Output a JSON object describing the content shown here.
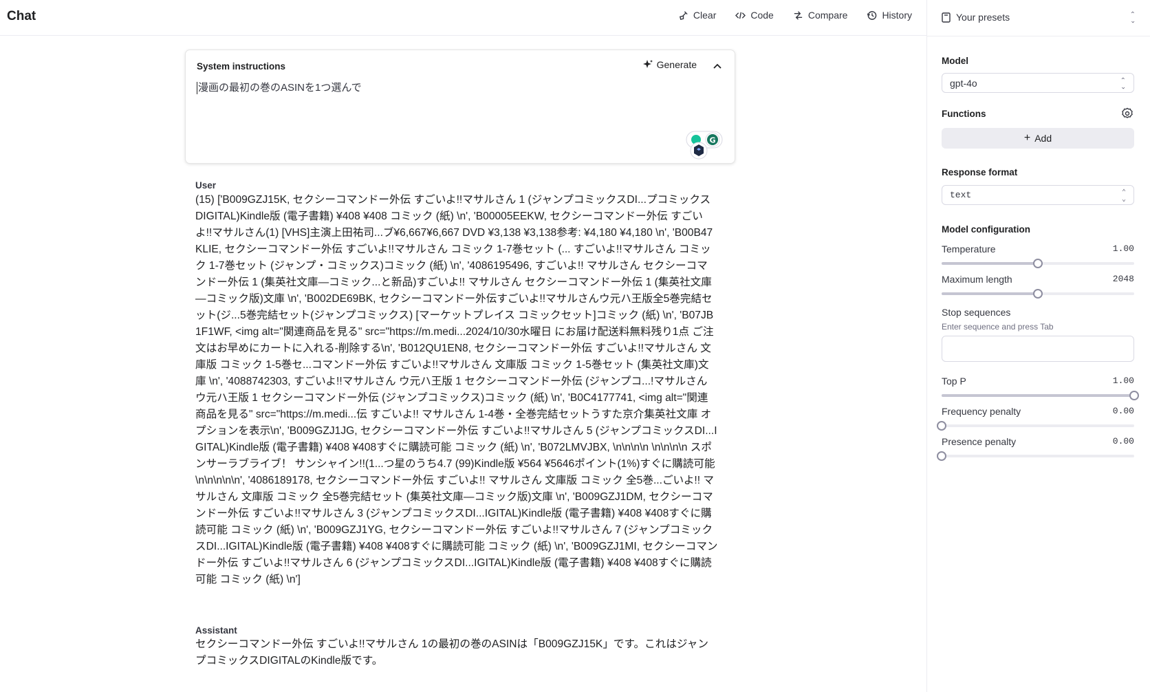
{
  "header": {
    "title": "Chat",
    "toolbar": [
      {
        "label": "Clear",
        "icon": "broom-icon"
      },
      {
        "label": "Code",
        "icon": "code-icon"
      },
      {
        "label": "Compare",
        "icon": "compare-icon"
      },
      {
        "label": "History",
        "icon": "history-icon"
      }
    ]
  },
  "panel": {
    "presets_label": "Your presets",
    "model_label": "Model",
    "model_value": "gpt-4o",
    "functions_label": "Functions",
    "add_label": "Add",
    "response_format_label": "Response format",
    "response_format_value": "text",
    "model_config_label": "Model configuration",
    "temperature": {
      "label": "Temperature",
      "value": "1.00",
      "fraction": 0.5
    },
    "max_length": {
      "label": "Maximum length",
      "value": "2048",
      "fraction": 0.5
    },
    "stop_sequences": {
      "label": "Stop sequences",
      "hint": "Enter sequence and press Tab"
    },
    "top_p": {
      "label": "Top P",
      "value": "1.00",
      "fraction": 1.0
    },
    "frequency_penalty": {
      "label": "Frequency penalty",
      "value": "0.00",
      "fraction": 0.0
    },
    "presence_penalty": {
      "label": "Presence penalty",
      "value": "0.00",
      "fraction": 0.0
    }
  },
  "system": {
    "label": "System instructions",
    "generate_label": "Generate",
    "text": "漫画の最初の巻のASINを1つ選んで"
  },
  "messages": [
    {
      "role": "User",
      "content": "(15) ['B009GZJ15K, セクシーコマンドー外伝 すごいよ!!マサルさん 1 (ジャンプコミックスDI...プコミックスDIGITAL)Kindle版 (電子書籍) ¥408 ¥408  コミック (紙) \\n', 'B00005EEKW, セクシーコマンドー外伝 すごいよ!!マサルさん(1) [VHS]主演上田祐司...ブ¥6,667¥6,667  DVD ¥3,138 ¥3,138参考: ¥4,180 ¥4,180  \\n', 'B00B47KLIE, セクシーコマンドー外伝 すごいよ!!マサルさん コミック 1-7巻セット (... すごいよ!!マサルさん コミック 1-7巻セット (ジャンプ・コミックス)コミック (紙) \\n', '4086195496, すごいよ!! マサルさん セクシーコマンドー外伝 1 (集英社文庫—コミック...と新品)すごいよ!! マサルさん セクシーコマンドー外伝 1 (集英社文庫—コミック版)文庫  \\n', 'B002DE69BK, セクシーコマンドー外伝すごいよ!!マサルさんウ元ハ王版全5巻完結セット(ジ...5巻完結セット(ジャンプコミックス) [マーケットプレイス コミックセット]コミック (紙) \\n', 'B07JB1F1WF, <img alt=\"関連商品を見る\" src=\"https://m.medi...2024/10/30水曜日 にお届け配送料無料残り1点 ご注文はお早めにカートに入れる-削除する\\n', 'B012QU1EN8, セクシーコマンドー外伝 すごいよ!!マサルさん 文庫版 コミック 1-5巻セ...コマンドー外伝 すごいよ!!マサルさん 文庫版 コミック 1-5巻セット (集英社文庫)文庫  \\n', '4088742303, すごいよ!!マサルさん ウ元ハ王版 1 セクシーコマンドー外伝 (ジャンプコ...!マサルさん ウ元ハ王版 1 セクシーコマンドー外伝 (ジャンプコミックス)コミック (紙) \\n', 'B0C4177741, <img alt=\"関連商品を見る\" src=\"https://m.medi...伝 すごいよ!! マサルさん 1-4巻・全巻完結セットうすた京介集英社文庫  オプションを表示\\n', 'B009GZJ1JG, セクシーコマンドー外伝 すごいよ!!マサルさん 5 (ジャンプコミックスDI...IGITAL)Kindle版 (電子書籍) ¥408 ¥408すぐに購読可能  コミック (紙) \\n', 'B072LMVJBX, \\n\\n\\n\\n   \\n\\n\\n\\n   スポンサーラブライブ！ サンシャイン!!(1...つ星のうち4.7 (99)Kindle版 ¥564 ¥5646ポイント(1%)すぐに購読可能\\n\\n\\n\\n\\n', '4086189178, セクシーコマンドー外伝 すごいよ!! マサルさん 文庫版 コミック 全5巻...ごいよ!! マサルさん 文庫版 コミック 全5巻完結セット (集英社文庫—コミック版)文庫  \\n', 'B009GZJ1DM, セクシーコマンドー外伝 すごいよ!!マサルさん 3 (ジャンプコミックスDI...IGITAL)Kindle版 (電子書籍) ¥408 ¥408すぐに購読可能  コミック (紙) \\n', 'B009GZJ1YG, セクシーコマンドー外伝 すごいよ!!マサルさん 7 (ジャンプコミックスDI...IGITAL)Kindle版 (電子書籍) ¥408 ¥408すぐに購読可能  コミック (紙) \\n', 'B009GZJ1MI, セクシーコマンドー外伝 すごいよ!!マサルさん 6 (ジャンプコミックスDI...IGITAL)Kindle版 (電子書籍) ¥408 ¥408すぐに購読可能  コミック (紙) \\n']"
    },
    {
      "role": "Assistant",
      "content": "セクシーコマンドー外伝 すごいよ!!マサルさん 1の最初の巻のASINは「B009GZJ15K」です。これはジャンプコミックスDIGITALのKindle版です。"
    }
  ],
  "colors": {
    "text": "#202123",
    "muted": "#6e6e80",
    "border": "#ececf1",
    "slider_track": "#ececf1",
    "thumb_border": "#8e8ea0"
  }
}
